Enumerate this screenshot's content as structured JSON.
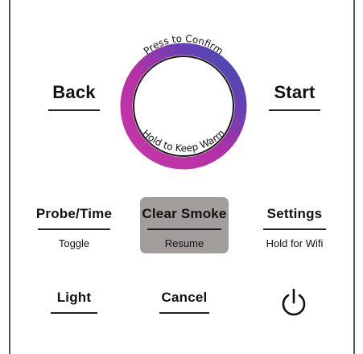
{
  "dial": {
    "top_text": "Press to Confirm",
    "bottom_text": "Hold to Keep Warm"
  },
  "buttons": {
    "back": "Back",
    "start": "Start",
    "probe_time": {
      "label": "Probe/Time",
      "sub": "Toggle"
    },
    "clear_smoke": {
      "label": "Clear Smoke",
      "sub": "Resume"
    },
    "settings": {
      "label": "Settings",
      "sub": "Hold for Wifi"
    },
    "light": "Light",
    "cancel": "Cancel"
  },
  "icons": {
    "power": "power-icon"
  },
  "colors": {
    "ring_top": "#5a3fb5",
    "ring_right": "#3b4fb0",
    "ring_left": "#c83aa8",
    "ring_bottom": "#b72fa5",
    "highlight": "#a09d9b"
  }
}
